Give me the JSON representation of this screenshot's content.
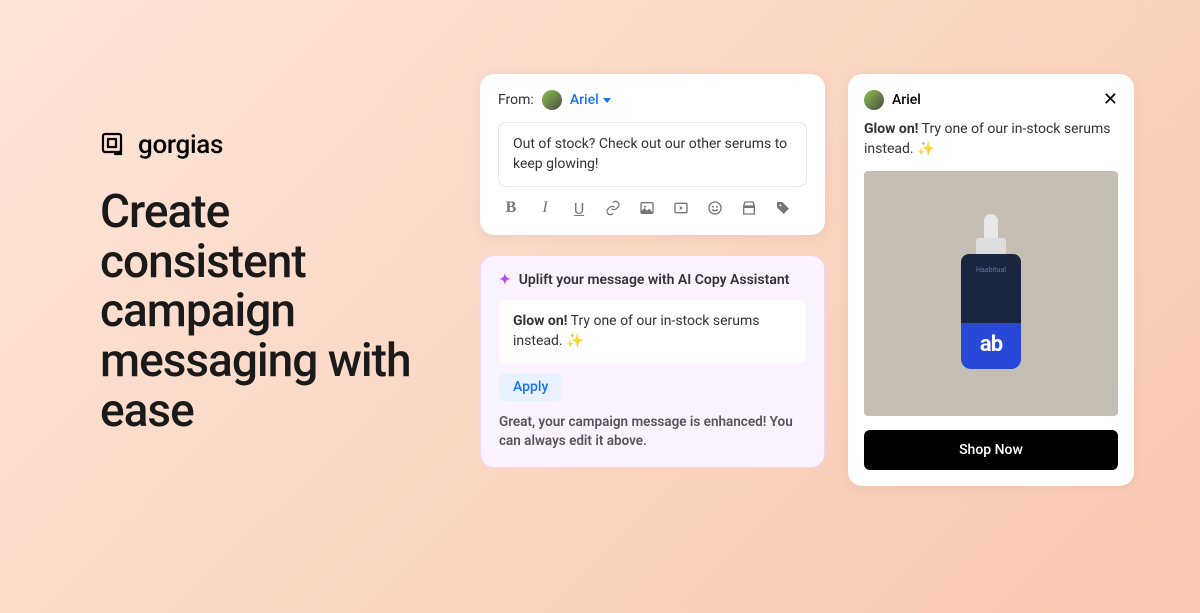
{
  "brand": {
    "name": "gorgias"
  },
  "headline": "Create consistent campaign messaging with ease",
  "composer": {
    "from_label": "From:",
    "sender_name": "Ariel",
    "draft_text": "Out of stock? Check out our other serums to keep glowing!",
    "tool_icons": [
      "bold",
      "italic",
      "underline",
      "link",
      "image",
      "video",
      "emoji",
      "shop",
      "tag"
    ]
  },
  "ai": {
    "title": "Uplift your message with AI Copy Assistant",
    "suggestion_bold": "Glow on!",
    "suggestion_rest": " Try one of our in-stock serums instead. ✨",
    "apply_label": "Apply",
    "footer": "Great, your campaign message is enhanced! You can always edit it above."
  },
  "preview": {
    "user_name": "Ariel",
    "msg_bold": "Glow on!",
    "msg_rest": " Try one of our in-stock serums instead. ✨",
    "product_tag": "Haabitual",
    "product_big": "ab",
    "cta_label": "Shop Now"
  }
}
